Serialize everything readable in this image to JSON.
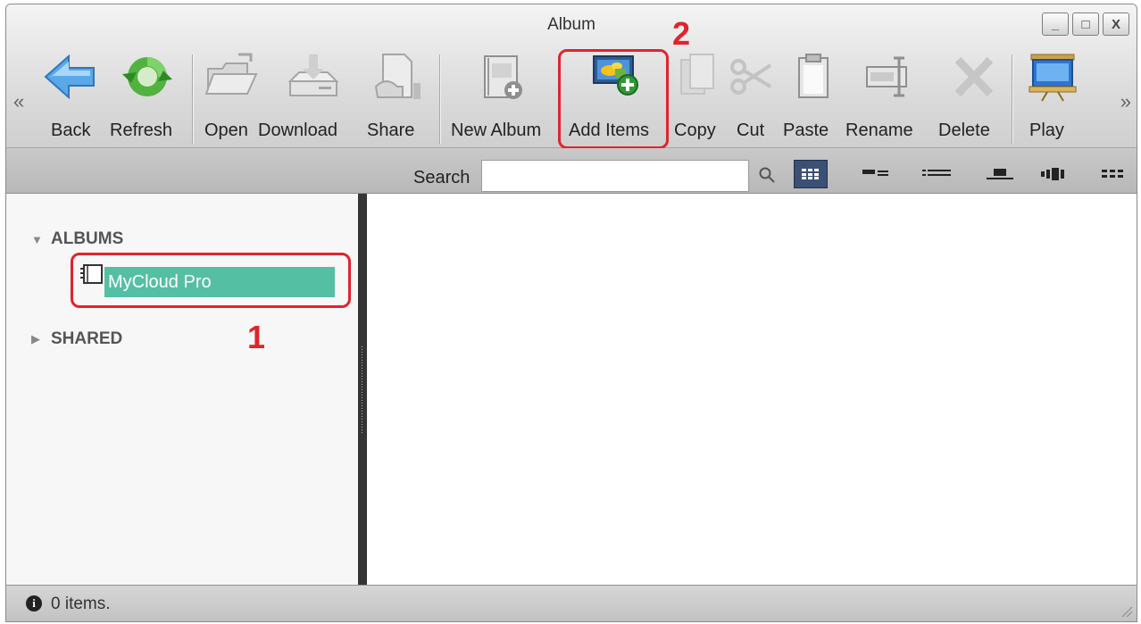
{
  "window": {
    "title": "Album",
    "controls": {
      "minimize": "_",
      "maximize": "□",
      "close": "X"
    }
  },
  "toolbar": {
    "scroll_left": "«",
    "scroll_right": "»",
    "back": "Back",
    "refresh": "Refresh",
    "open": "Open",
    "download": "Download",
    "share": "Share",
    "new_album": "New Album",
    "add_items": "Add Items",
    "copy": "Copy",
    "cut": "Cut",
    "paste": "Paste",
    "rename": "Rename",
    "delete": "Delete",
    "play": "Play"
  },
  "search": {
    "label": "Search",
    "value": "",
    "placeholder": ""
  },
  "sidebar": {
    "sections": [
      {
        "label": "ALBUMS",
        "expanded": true,
        "items": [
          {
            "label": "MyCloud Pro",
            "selected": true
          }
        ]
      },
      {
        "label": "SHARED",
        "expanded": false,
        "items": []
      }
    ]
  },
  "annotations": {
    "step1": "1",
    "step2": "2"
  },
  "status": {
    "text": "0 items."
  },
  "colors": {
    "highlight": "#e0242c",
    "selection": "#55bfa4",
    "active_view": "#3c4f74"
  }
}
